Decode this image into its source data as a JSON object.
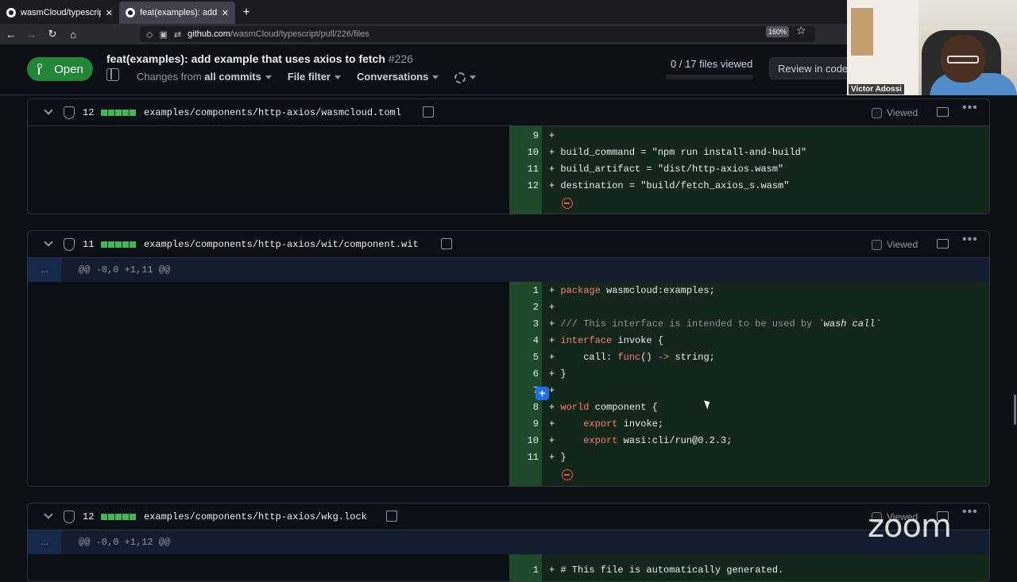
{
  "browser": {
    "tabs": [
      {
        "title": "wasmCloud/typescript",
        "close": "✕"
      },
      {
        "title": "feat(examples): add exam",
        "close": "✕"
      }
    ],
    "new_tab": "+",
    "url_host": "github.com",
    "url_path": "/wasmCloud/typescript/pull/226/files",
    "zoom": "160%"
  },
  "pr": {
    "status": "Open",
    "title": "feat(examples): add example that uses axios to fetch",
    "number": "#226",
    "changes_from_prefix": "Changes from",
    "changes_from_value": "all commits",
    "file_filter": "File filter",
    "conversations": "Conversations",
    "files_viewed": "0 / 17 files viewed",
    "review_button": "Review in codespace"
  },
  "video": {
    "participant_name": "Victor Adossi",
    "app_logo": "zoom"
  },
  "files": [
    {
      "count": "12",
      "path": "examples/components/http-axios/wasmcloud.toml",
      "viewed_label": "Viewed",
      "lines": [
        {
          "n": "9",
          "text": "+ "
        },
        {
          "n": "10",
          "text": "+ build_command = \"npm run install-and-build\""
        },
        {
          "n": "11",
          "text": "+ build_artifact = \"dist/http-axios.wasm\""
        },
        {
          "n": "12",
          "text": "+ destination = \"build/fetch_axios_s.wasm\""
        }
      ]
    },
    {
      "count": "11",
      "path": "examples/components/http-axios/wit/component.wit",
      "viewed_label": "Viewed",
      "expand": "...",
      "hunk": "@@ -0,0 +1,11 @@",
      "lines": [
        {
          "n": "1",
          "text": "+ package wasmcloud:examples;"
        },
        {
          "n": "2",
          "text": "+ "
        },
        {
          "n": "3",
          "text": "+ /// This interface is intended to be used by `wash call`"
        },
        {
          "n": "4",
          "text": "+ interface invoke {"
        },
        {
          "n": "5",
          "text": "+     call: func() -> string;"
        },
        {
          "n": "6",
          "text": "+ }"
        },
        {
          "n": "7",
          "text": "+ "
        },
        {
          "n": "8",
          "text": "+ world component {"
        },
        {
          "n": "9",
          "text": "+     export invoke;"
        },
        {
          "n": "10",
          "text": "+     export wasi:cli/run@0.2.3;"
        },
        {
          "n": "11",
          "text": "+ }"
        }
      ]
    },
    {
      "count": "12",
      "path": "examples/components/http-axios/wkg.lock",
      "viewed_label": "Viewed",
      "expand": "...",
      "hunk": "@@ -0,0 +1,12 @@",
      "lines": [
        {
          "n": "1",
          "text": "+ # This file is automatically generated."
        }
      ]
    }
  ],
  "colors": {
    "open_green": "#238636",
    "added_line_bg": "#13281b",
    "added_num_bg": "#1f4a2b",
    "accent_blue": "#1f6feb"
  }
}
